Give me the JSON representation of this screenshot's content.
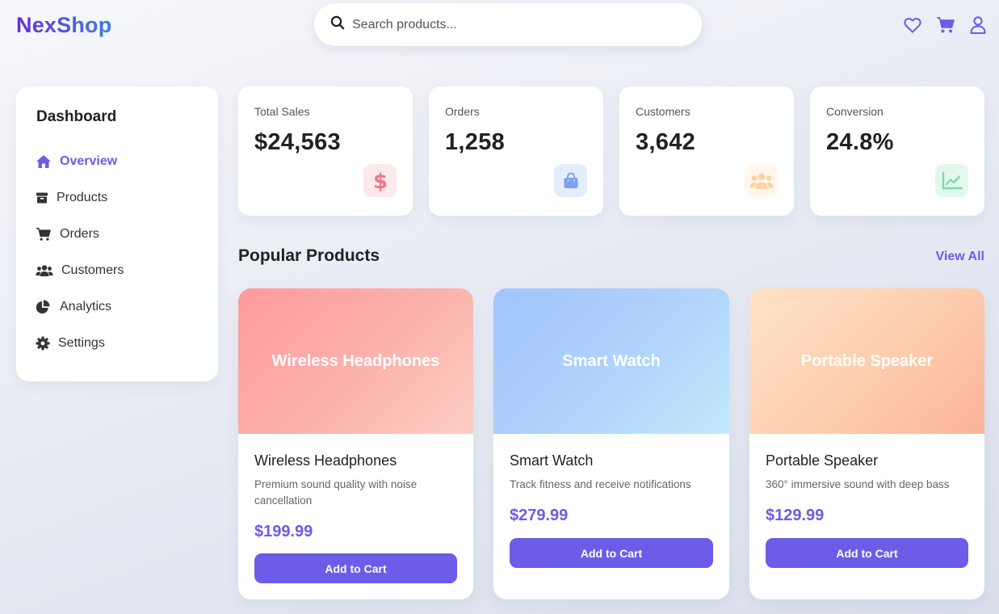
{
  "brand": {
    "name": "NexShop"
  },
  "search": {
    "placeholder": "Search products..."
  },
  "header_icons": [
    "heart-icon",
    "cart-icon",
    "user-icon"
  ],
  "sidebar": {
    "title": "Dashboard",
    "items": [
      {
        "label": "Overview",
        "icon": "home-icon",
        "active": true
      },
      {
        "label": "Products",
        "icon": "box-icon",
        "active": false
      },
      {
        "label": "Orders",
        "icon": "cart-icon",
        "active": false
      },
      {
        "label": "Customers",
        "icon": "users-icon",
        "active": false
      },
      {
        "label": "Analytics",
        "icon": "pie-chart-icon",
        "active": false
      },
      {
        "label": "Settings",
        "icon": "gear-icon",
        "active": false
      }
    ]
  },
  "stats": [
    {
      "label": "Total Sales",
      "value": "$24,563",
      "icon": "dollar-icon",
      "color": "#f25c73"
    },
    {
      "label": "Orders",
      "value": "1,258",
      "icon": "bag-icon",
      "color": "#5b8def"
    },
    {
      "label": "Customers",
      "value": "3,642",
      "icon": "users-icon",
      "color": "#f7b267"
    },
    {
      "label": "Conversion",
      "value": "24.8%",
      "icon": "trend-chart-icon",
      "color": "#34c77b"
    }
  ],
  "popular": {
    "title": "Popular Products",
    "view_all": "View All"
  },
  "products": [
    {
      "banner": "Wireless Headphones",
      "name": "Wireless Headphones",
      "description": "Premium sound quality with noise cancellation",
      "price": "$199.99",
      "button": "Add to Cart"
    },
    {
      "banner": "Smart Watch",
      "name": "Smart Watch",
      "description": "Track fitness and receive notifications",
      "price": "$279.99",
      "button": "Add to Cart"
    },
    {
      "banner": "Portable Speaker",
      "name": "Portable Speaker",
      "description": "360° immersive sound with deep bass",
      "price": "$129.99",
      "button": "Add to Cart"
    }
  ],
  "colors": {
    "accent": "#6c5ce7",
    "logo_start": "#6a2bd8",
    "logo_end": "#3d7fe6"
  }
}
